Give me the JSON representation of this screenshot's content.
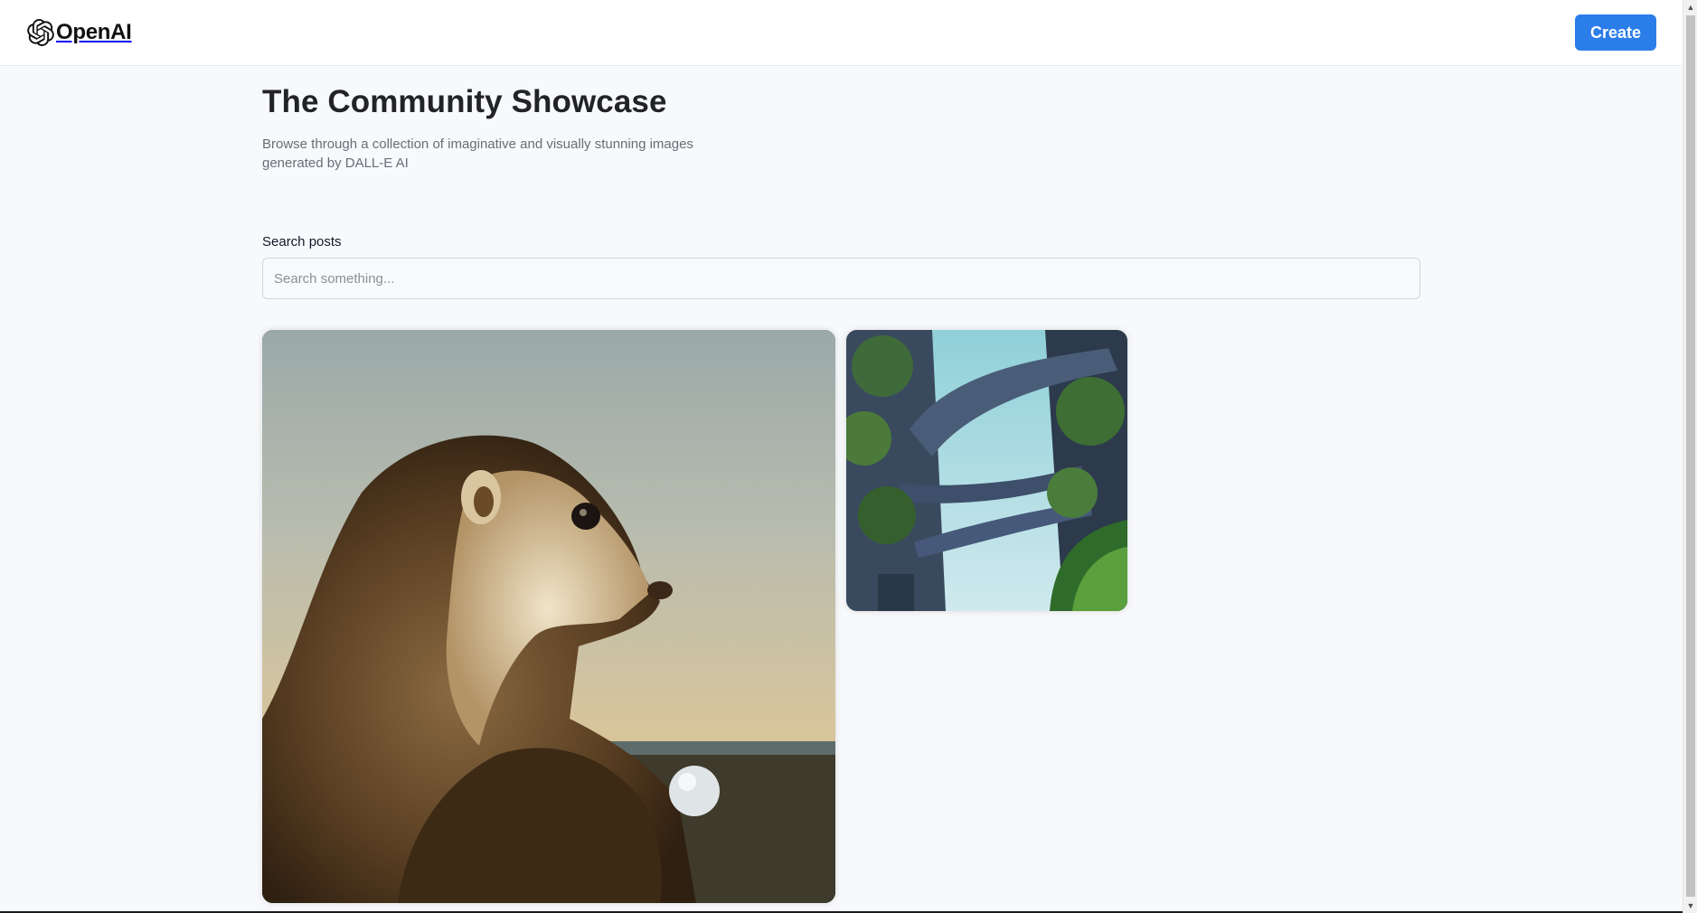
{
  "header": {
    "brand": "OpenAI",
    "logo_icon": "openai-logo-icon",
    "create_label": "Create",
    "accent_color": "#2b7de9"
  },
  "main": {
    "title": "The Community Showcase",
    "description": "Browse through a collection of imaginative and visually stunning images generated by DALL-E AI",
    "search": {
      "label": "Search posts",
      "placeholder": "Search something...",
      "value": ""
    }
  },
  "gallery": {
    "cards": [
      {
        "name": "otter-painting-image"
      },
      {
        "name": "futuristic-city-image"
      }
    ]
  },
  "scrollbar": {
    "up_icon": "chevron-up-icon",
    "down_icon": "chevron-down-icon"
  }
}
